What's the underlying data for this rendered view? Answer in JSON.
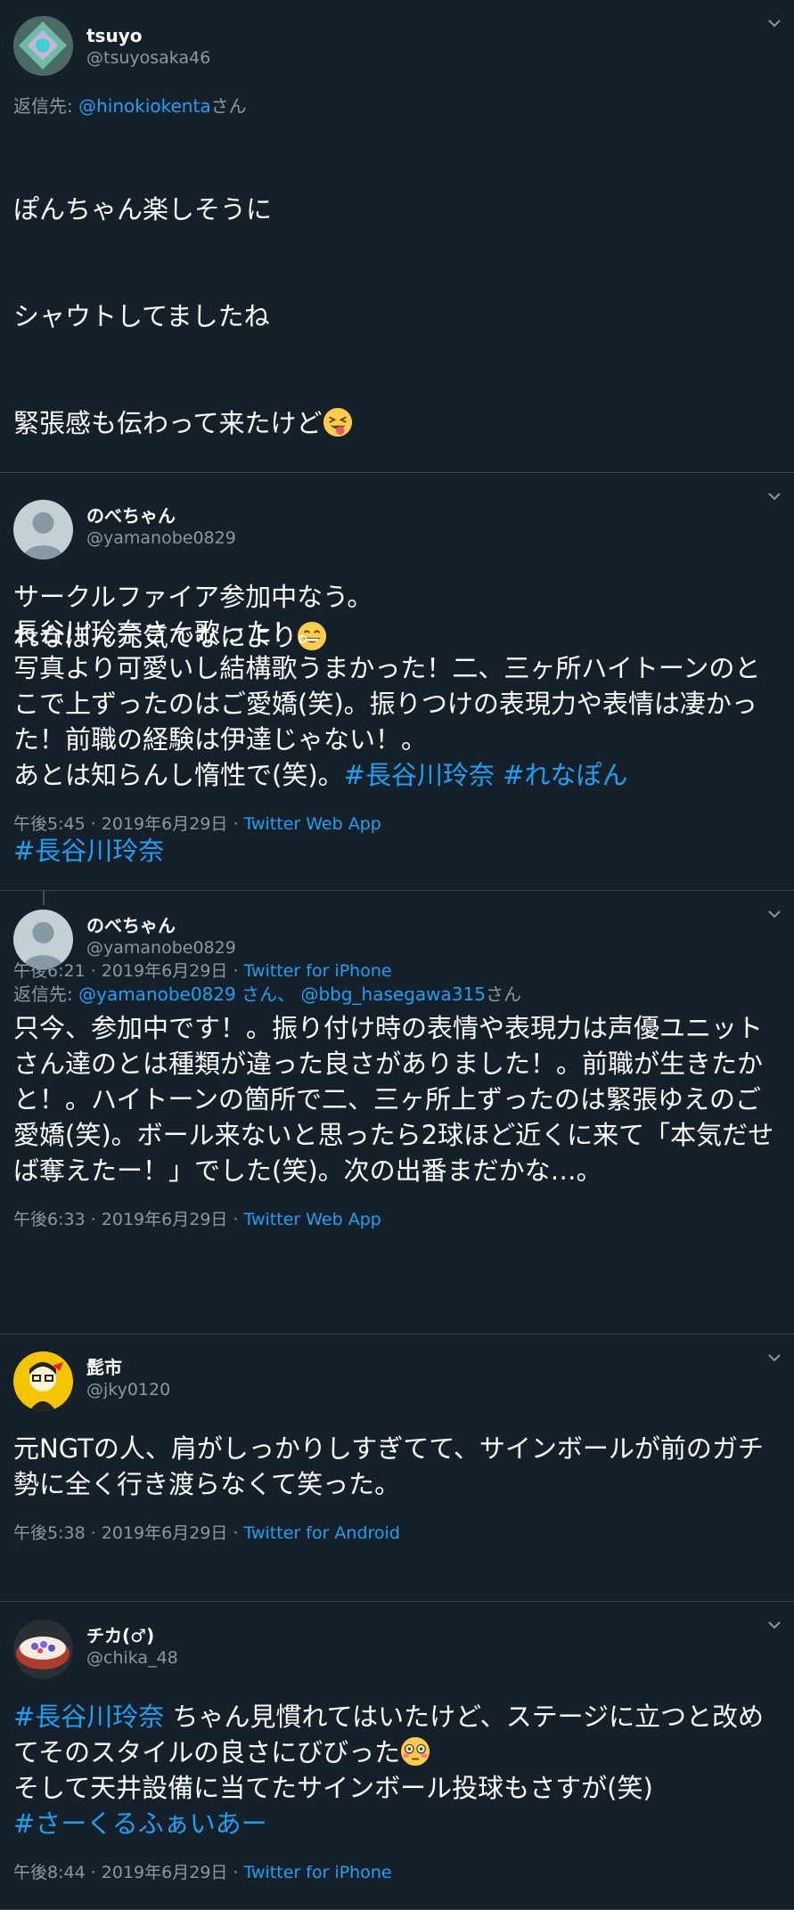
{
  "tweets": [
    {
      "display_name": "tsuyo",
      "handle": "@tsuyosaka46",
      "reply_prefix": "返信先: ",
      "reply_to": "@hinokiokenta",
      "reply_suffix": "さん",
      "line1": "ぽんちゃん楽しそうに",
      "line2": "シャウトしてましたね",
      "line3": "緊張感も伝わって来たけど",
      "line4": "れなぽん元気でなにより",
      "hashtag": "#長谷川玲奈",
      "time": "午後6:21 · 2019年6月29日 · ",
      "source": "Twitter for iPhone"
    },
    {
      "display_name": "のべちゃん",
      "handle": "@yamanobe0829",
      "body": "サークルファイア参加中なう。\n長谷川玲奈さん歌った！。\n写真より可愛いし結構歌うまかった！二、三ヶ所ハイトーンのとこで上ずったのはご愛嬌(笑)。振りつけの表現力や表情は凄かった！前職の経験は伊達じゃない！。\nあとは知らんし惰性で(笑)。",
      "hashtag1": "#長谷川玲奈",
      "hashtag2": "#れなぽん",
      "time": "午後5:45 · 2019年6月29日 · ",
      "source": "Twitter Web App"
    },
    {
      "display_name": "のべちゃん",
      "handle": "@yamanobe0829",
      "reply_prefix": "返信先: ",
      "reply_to1": "@yamanobe0829",
      "reply_mid": " さん、 ",
      "reply_to2": "@bbg_hasegawa315",
      "reply_suffix": "さん",
      "body": "只今、参加中です！。振り付け時の表情や表現力は声優ユニットさん達のとは種類が違った良さがありました！。前職が生きたかと！。ハイトーンの箇所で二、三ヶ所上ずったのは緊張ゆえのご愛嬌(笑)。ボール来ないと思ったら2球ほど近くに来て「本気だせば奪えたー！」でした(笑)。次の出番まだかな…。",
      "time": "午後6:33 · 2019年6月29日 · ",
      "source": "Twitter Web App"
    },
    {
      "display_name": "髭市",
      "handle": "@jky0120",
      "body": "元NGTの人、肩がしっかりしすぎてて、サインボールが前のガチ勢に全く行き渡らなくて笑った。",
      "time": "午後5:38 · 2019年6月29日 · ",
      "source": "Twitter for Android"
    },
    {
      "display_name": "チカ(♂)",
      "handle": "@chika_48",
      "hashtag1": "#長谷川玲奈",
      "line1": " ちゃん見慣れてはいたけど、ステージに立つと改めてそのスタイルの良さにびびった",
      "line2": "そして天井設備に当てたサインボール投球もさすが(笑)",
      "hashtag2": "#さーくるふぁいあー",
      "time": "午後8:44 · 2019年6月29日 · ",
      "source": "Twitter for iPhone"
    }
  ],
  "colors": {
    "bg": "#15202b",
    "accent": "#1da1f2",
    "muted": "#8899a6",
    "divider": "#38444d"
  }
}
